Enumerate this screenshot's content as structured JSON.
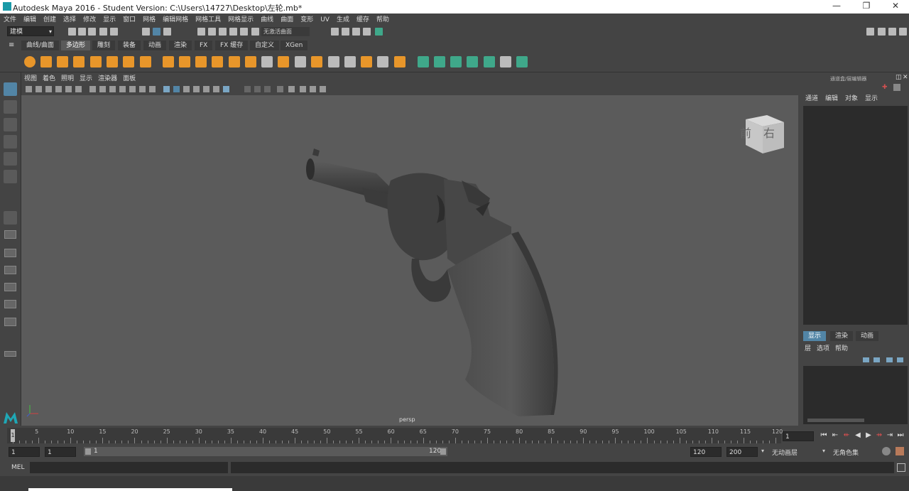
{
  "window": {
    "title": "Autodesk Maya 2016 - Student Version: C:\\Users\\14727\\Desktop\\左轮.mb*",
    "minimize": "—",
    "maximize": "❐",
    "close": "✕"
  },
  "menubar": [
    "文件",
    "编辑",
    "创建",
    "选择",
    "修改",
    "显示",
    "窗口",
    "网格",
    "编辑网格",
    "网格工具",
    "网格显示",
    "曲线",
    "曲面",
    "变形",
    "UV",
    "生成",
    "缓存",
    "帮助"
  ],
  "statusline": {
    "mode": "建模",
    "live_surface": "无激活曲面"
  },
  "shelf_tabs": [
    "曲线/曲面",
    "多边形",
    "雕刻",
    "装备",
    "动画",
    "渲染",
    "FX",
    "FX 缓存",
    "自定义",
    "XGen"
  ],
  "shelf_active_tab": "多边形",
  "viewport": {
    "menu": [
      "视图",
      "着色",
      "照明",
      "显示",
      "渲染器",
      "面板"
    ],
    "camera_label": "persp",
    "viewcube_front": "前",
    "viewcube_right": "右"
  },
  "channel_box": {
    "header": "通道盒/层编辑器",
    "menu": [
      "通道",
      "编辑",
      "对象",
      "显示"
    ]
  },
  "layer_editor": {
    "tabs": [
      "显示",
      "渲染",
      "动画"
    ],
    "active_tab": "显示",
    "menu": [
      "层",
      "选项",
      "帮助"
    ]
  },
  "time_slider": {
    "labels": [
      "5",
      "10",
      "15",
      "20",
      "25",
      "30",
      "35",
      "40",
      "45",
      "50",
      "55",
      "60",
      "65",
      "70",
      "75",
      "80",
      "85",
      "90",
      "95",
      "100",
      "105",
      "110",
      "115",
      "120"
    ],
    "current_marker": "1",
    "current_frame": "1"
  },
  "range_slider": {
    "start_field": "1",
    "start_field2": "1",
    "bar_start": "1",
    "bar_end": "120",
    "end_field": "120",
    "end_field2": "200",
    "anim_layer": "无动画层",
    "character_set": "无角色集"
  },
  "command_line": {
    "label": "MEL"
  },
  "colors": {
    "accent": "#5285a6",
    "viewport_bg": "#5b5b5b",
    "panel_bg": "#444444",
    "shelf_green": "#3fa88a"
  }
}
